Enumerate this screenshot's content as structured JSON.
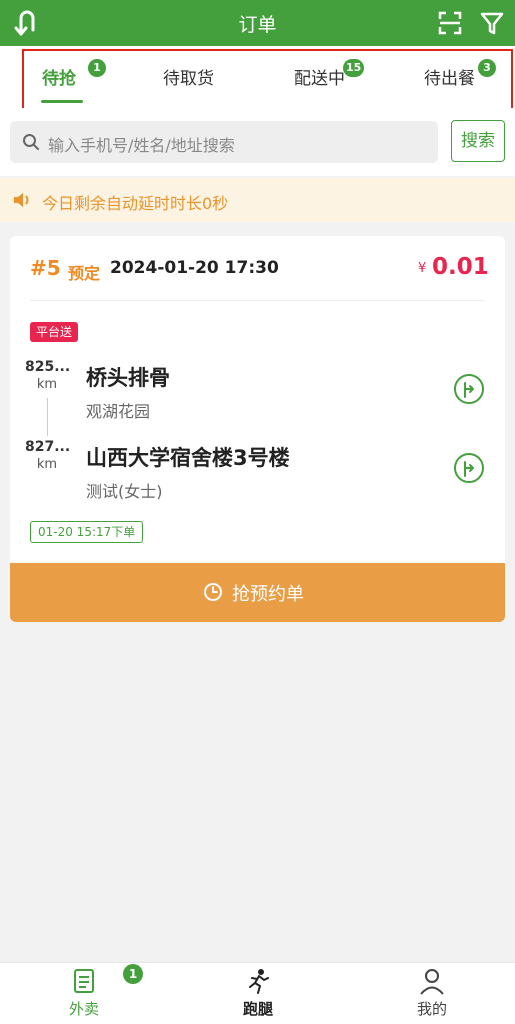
{
  "header": {
    "title": "订单",
    "back_icon": "back-arrow-icon",
    "scan_icon": "scan-icon",
    "filter_icon": "filter-icon",
    "bg_color": "#44a03d"
  },
  "tabs": [
    {
      "label": "待抢",
      "badge": "1",
      "active": true
    },
    {
      "label": "待取货",
      "badge": "",
      "active": false
    },
    {
      "label": "配送中",
      "badge": "15",
      "active": false
    },
    {
      "label": "待出餐",
      "badge": "3",
      "active": false
    }
  ],
  "search": {
    "placeholder": "输入手机号/姓名/地址搜索",
    "button_label": "搜索"
  },
  "notice": {
    "text": "今日剩余自动延时时长0秒"
  },
  "order": {
    "number": "#5",
    "type": "预定",
    "datetime": "2024-01-20 17:30",
    "currency": "¥",
    "price": "0.01",
    "delivery_tag": "平台送",
    "pickup": {
      "distance": "825...",
      "unit": "km",
      "name": "桥头排骨",
      "sub": "观湖花园"
    },
    "dropoff": {
      "distance": "827...",
      "unit": "km",
      "name": "山西大学宿舍楼3号楼",
      "sub": "测试(女士)"
    },
    "order_time": "01-20 15:17下单",
    "action_label": "抢预约单"
  },
  "bottom_nav": [
    {
      "label": "外卖",
      "icon": "list-document-icon",
      "active": true
    },
    {
      "label": "跑腿",
      "icon": "runner-icon",
      "active": false
    },
    {
      "label": "我的",
      "icon": "user-icon",
      "active": false
    }
  ],
  "bottom_badge": "1",
  "colors": {
    "primary_green": "#44a03d",
    "accent_orange": "#f08a24",
    "price_red": "#e8254f",
    "button_orange": "#e99d45",
    "highlight_red": "#e2231a"
  }
}
